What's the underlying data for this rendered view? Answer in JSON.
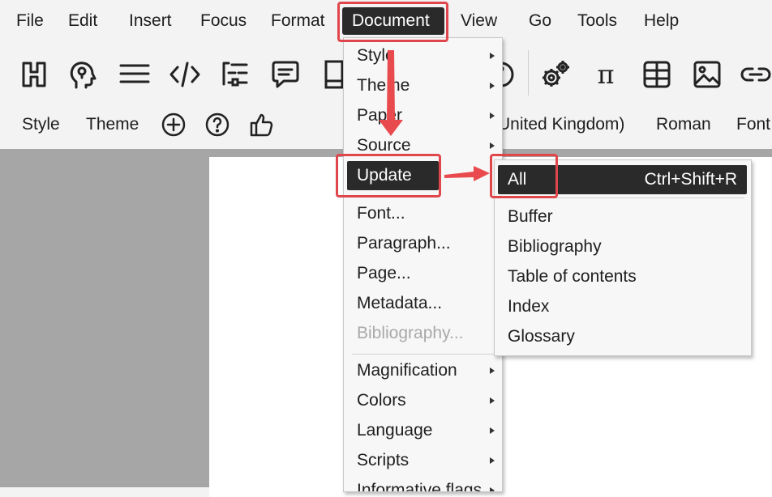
{
  "menubar": {
    "items": [
      {
        "label": "File"
      },
      {
        "label": "Edit"
      },
      {
        "label": "Insert"
      },
      {
        "label": "Focus"
      },
      {
        "label": "Format"
      },
      {
        "label": "Document"
      },
      {
        "label": "View"
      },
      {
        "label": "Go"
      },
      {
        "label": "Tools"
      },
      {
        "label": "Help"
      }
    ],
    "active": "Document"
  },
  "toolbar": {
    "icons": [
      "heading-icon",
      "lightbulb-head-icon",
      "paragraph-lines-icon",
      "code-icon",
      "list-tree-icon",
      "comment-icon",
      "notebook-icon",
      "gears-icon",
      "pi-icon",
      "table-icon",
      "image-icon",
      "link-icon"
    ],
    "pi_glyph": "π"
  },
  "propbar": {
    "style_label": "Style",
    "theme_label": "Theme",
    "language_partial": "United Kingdom)",
    "script_label": "Roman",
    "font_partial": "Font"
  },
  "document_menu": {
    "items": [
      {
        "label": "Style",
        "submenu": true
      },
      {
        "label": "Theme",
        "submenu": true
      },
      {
        "label": "Paper",
        "submenu": true
      },
      {
        "label": "Source",
        "submenu": true
      },
      {
        "label": "Update",
        "submenu": true,
        "active": true
      },
      {
        "label": "Font..."
      },
      {
        "label": "Paragraph..."
      },
      {
        "label": "Page..."
      },
      {
        "label": "Metadata..."
      },
      {
        "label": "Bibliography...",
        "disabled": true
      },
      {
        "label": "Magnification",
        "submenu": true
      },
      {
        "label": "Colors",
        "submenu": true
      },
      {
        "label": "Language",
        "submenu": true
      },
      {
        "label": "Scripts",
        "submenu": true
      },
      {
        "label": "Informative flags",
        "submenu": true
      }
    ]
  },
  "update_submenu": {
    "items": [
      {
        "label": "All",
        "shortcut": "Ctrl+Shift+R",
        "active": true
      },
      {
        "label": "Buffer"
      },
      {
        "label": "Bibliography"
      },
      {
        "label": "Table of contents"
      },
      {
        "label": "Index"
      },
      {
        "label": "Glossary"
      }
    ]
  },
  "colors": {
    "highlight": "#e0474c",
    "active_bg": "#2a2a2a",
    "workspace": "#a6a6a6",
    "chrome": "#f3f3f3"
  }
}
